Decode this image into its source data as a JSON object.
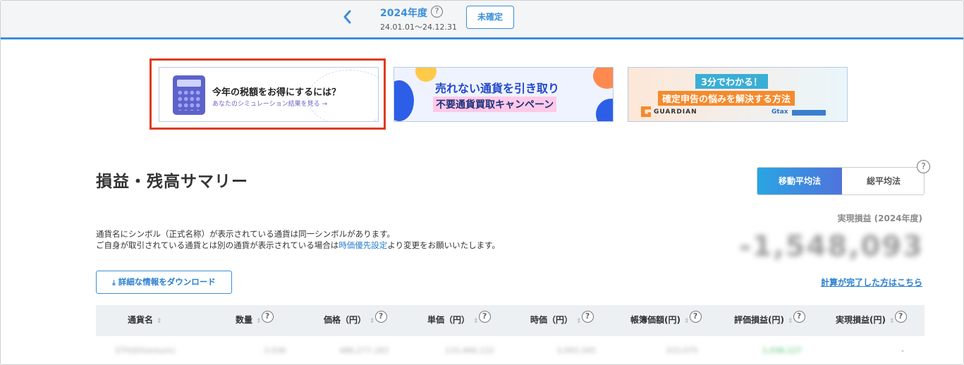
{
  "header": {
    "year": "2024年度",
    "help": "?",
    "period": "24.01.01〜24.12.31",
    "status_button": "未確定",
    "accent": "#3b8fd9"
  },
  "banners": {
    "tax": {
      "title": "今年の税額をお得にするには？",
      "subtitle": "あなたのシミュレーション結果を見る"
    },
    "campaign": {
      "line1": "売れない通貨を引き取り",
      "line2": "不要通貨買取キャンペーン"
    },
    "guardian": {
      "line1": "3分でわかる！",
      "line2": "確定申告の悩みを解決する方法",
      "logo1": "GUARDIAN",
      "logo2": "Gtax"
    }
  },
  "summary": {
    "title": "損益・残高サマリー",
    "method_moving": "移動平均法",
    "method_total": "総平均法",
    "help": "?",
    "realized_label": "実現損益 (2024年度)",
    "realized_value": "-1,548,093",
    "calc_done_link": "計算が完了した方はこちら",
    "note1": "通貨名にシンボル（正式名称）が表示されている通貨は同一シンボルがあります。",
    "note2_prefix": "ご自身が取引されている通貨とは別の通貨が表示されている場合は",
    "note2_link": "時価優先設定",
    "note2_suffix": "より変更をお願いいたします。",
    "download_label": "詳細な情報をダウンロード"
  },
  "table": {
    "headers": [
      "通貨名",
      "数量",
      "価格（円）",
      "単価（円）",
      "時価（円）",
      "帳簿価額(円)",
      "評価損益(円)",
      "実現損益(円)"
    ],
    "sort_glyph": "⇕",
    "help": "?",
    "rows": [
      [
        "ETH(Ethereum)",
        "3.036",
        "486,277,183",
        "133,466,122",
        "3,093,345",
        "333,075",
        "1,036,127",
        "-"
      ]
    ]
  }
}
